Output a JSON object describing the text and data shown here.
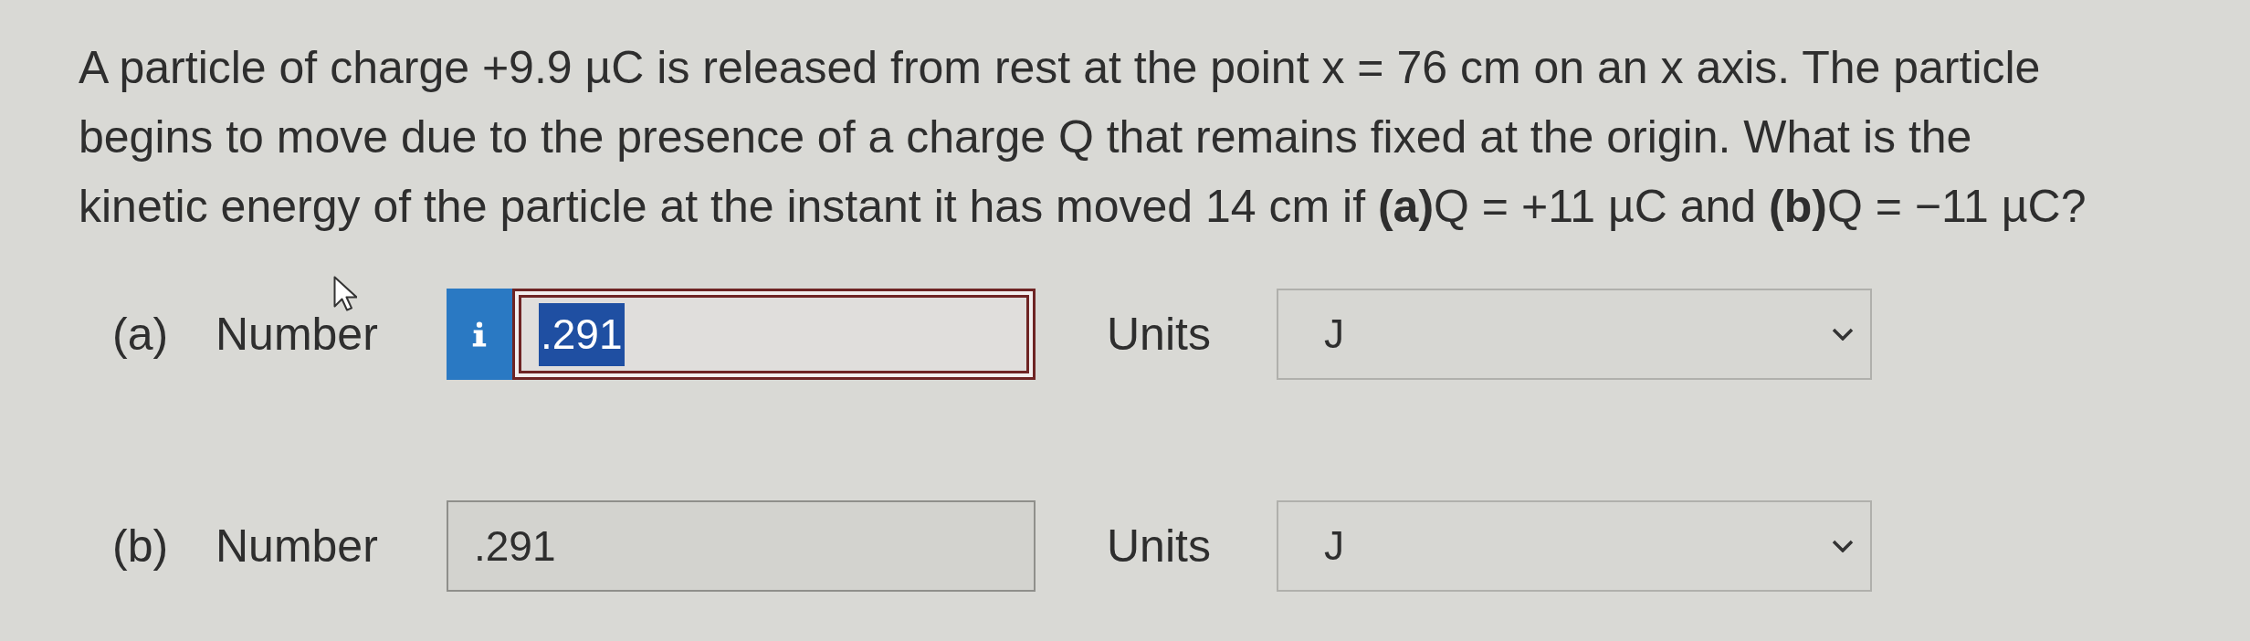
{
  "question": {
    "text": "A particle of charge +9.9 µC is released from rest at the point x = 76 cm on an x axis. The particle begins to move due to the presence of a charge Q that remains fixed at the origin. What is the kinetic energy of the particle at the instant it has moved 14 cm if **(a)**Q = +11 µC and **(b)**Q = −11 µC?"
  },
  "parts": [
    {
      "label": "(a)",
      "field_label": "Number",
      "info_button": true,
      "value": ".291",
      "focused": true,
      "text_selected": true,
      "units_label": "Units",
      "units_value": "J"
    },
    {
      "label": "(b)",
      "field_label": "Number",
      "info_button": false,
      "value": ".291",
      "focused": false,
      "text_selected": false,
      "units_label": "Units",
      "units_value": "J"
    }
  ]
}
